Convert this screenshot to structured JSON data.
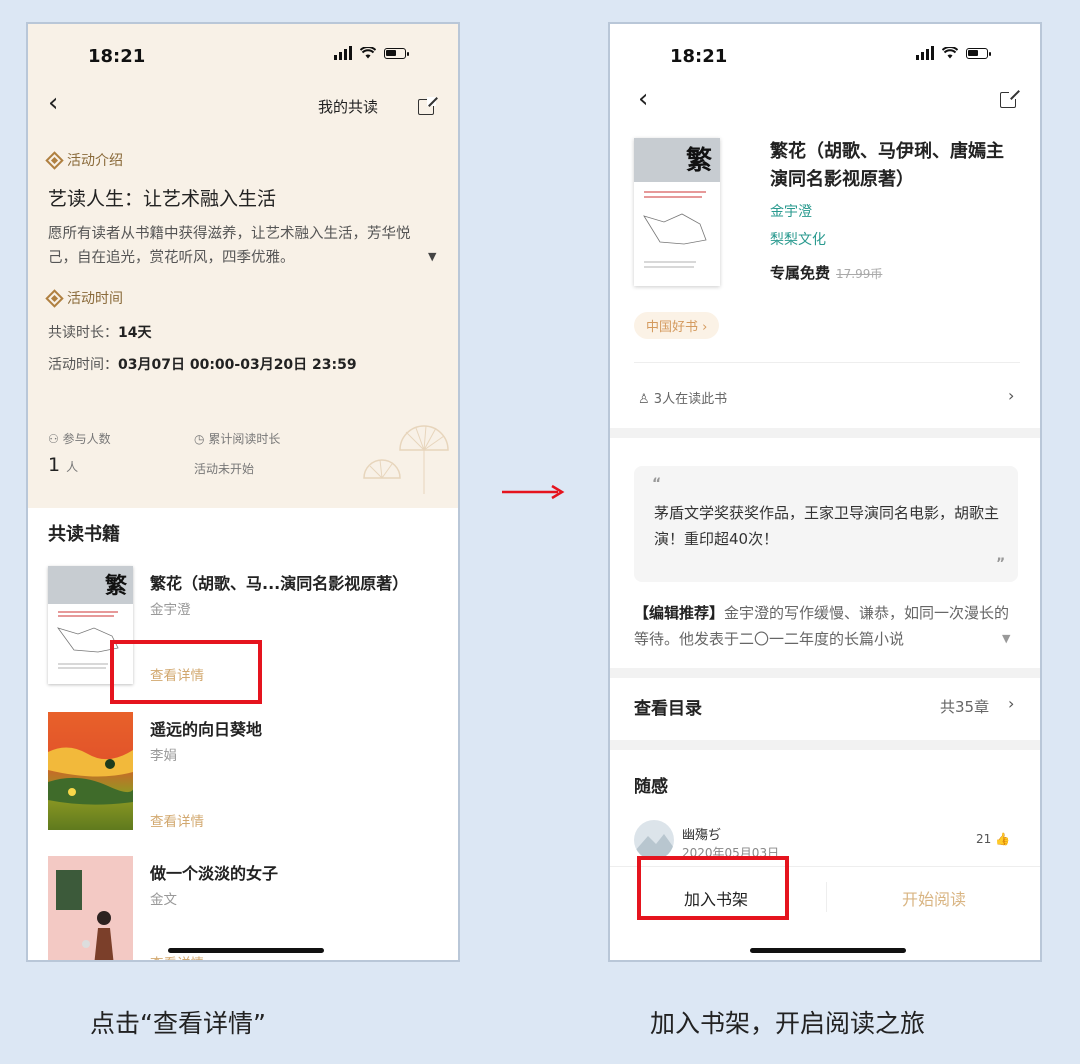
{
  "left_screen": {
    "status_time": "18:21",
    "header_link": "我的共读",
    "activity_intro_label": "活动介绍",
    "activity_title": "艺读人生：让艺术融入生活",
    "activity_desc": "愿所有读者从书籍中获得滋养，让艺术融入生活，芳华悦己，自在追光，赏花听风，四季优雅。",
    "activity_time_label": "活动时间",
    "duration_label": "共读时长：",
    "duration_value": "14天",
    "time_label": "活动时间：",
    "time_value": "03月07日 00:00-03月20日 23:59",
    "participants_label": "参与人数",
    "participants_value": "1",
    "participants_unit": "人",
    "reading_time_label": "累计阅读时长",
    "reading_time_value": "活动未开始",
    "books_section_title": "共读书籍",
    "books": [
      {
        "title": "繁花（胡歌、马...演同名影视原著）",
        "author": "金宇澄",
        "link": "查看详情"
      },
      {
        "title": "遥远的向日葵地",
        "author": "李娟",
        "link": "查看详情"
      },
      {
        "title": "做一个淡淡的女子",
        "author": "金文",
        "link": "查看详情"
      }
    ]
  },
  "right_screen": {
    "status_time": "18:21",
    "book_title": "繁花（胡歌、马伊琍、唐嫣主演同名影视原著）",
    "author": "金宇澄",
    "publisher": "梨梨文化",
    "price_label": "专属免费",
    "original_price": "17.99币",
    "tag": "中国好书",
    "readers": "3人在读此书",
    "quote": "茅盾文学奖获奖作品，王家卫导演同名电影，胡歌主演！重印超40次！",
    "recommend_label": "【编辑推荐】",
    "recommend_text": "金宇澄的写作缓慢、谦恭，如同一次漫长的等待。他发表于二〇一二年度的长篇小说",
    "toc_label": "查看目录",
    "toc_count": "共35章",
    "notes_title": "随感",
    "note_user": "幽殤ぢ",
    "note_date": "2020年05月03日",
    "note_likes": "21",
    "add_to_shelf": "加入书架",
    "start_reading": "开始阅读"
  },
  "captions": {
    "left": "点击“查看详情”",
    "right": "加入书架，开启阅读之旅"
  },
  "colors": {
    "background": "#dce7f4",
    "highlight": "#e5141e",
    "accent_gold": "#d2a86f",
    "accent_teal": "#2a9a8f"
  }
}
